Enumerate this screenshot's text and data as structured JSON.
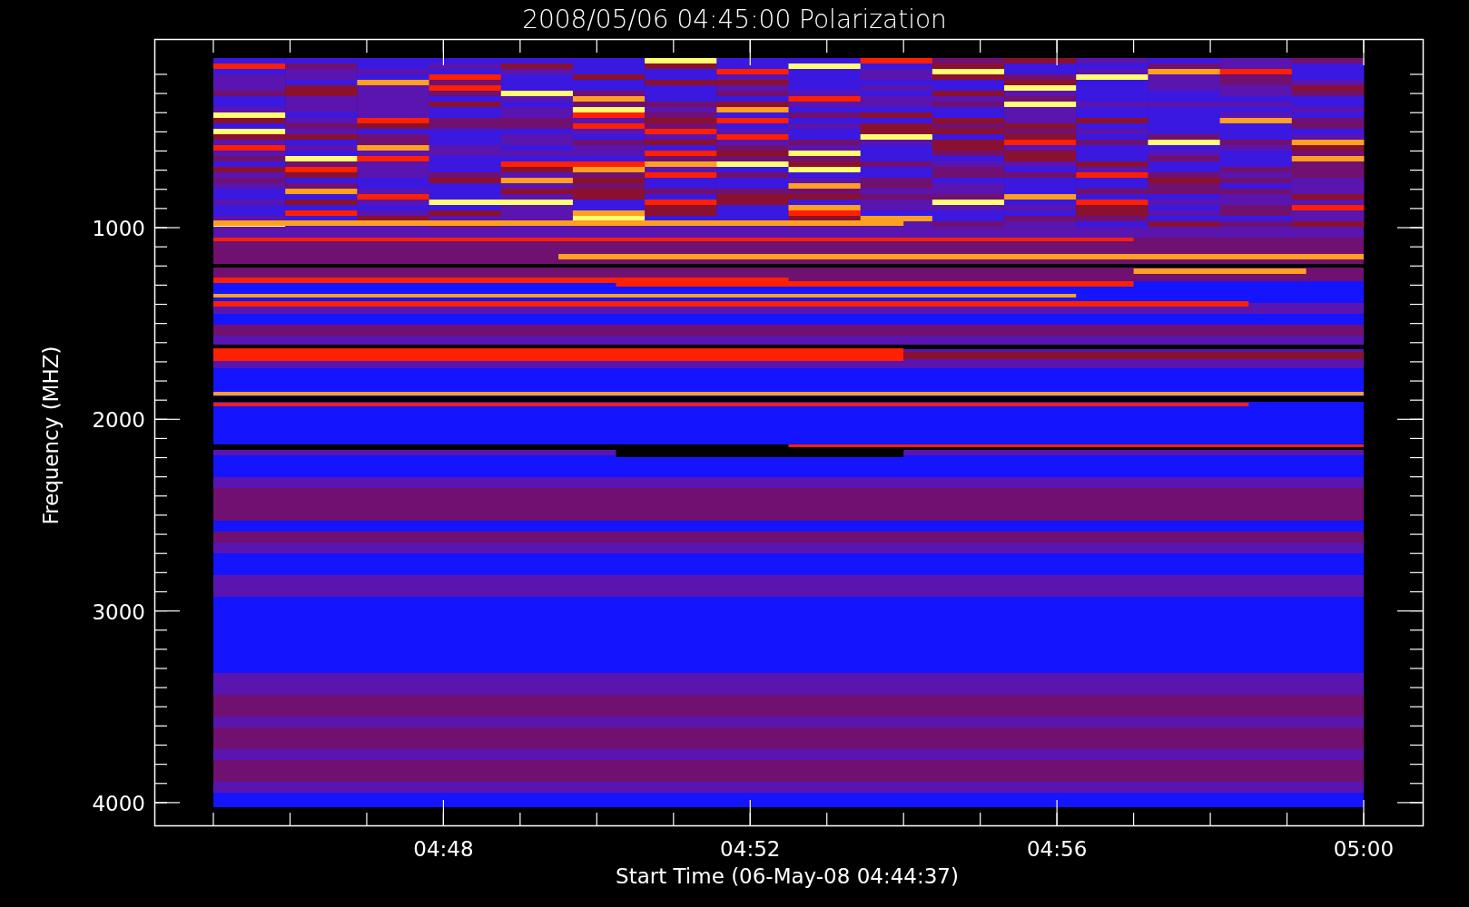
{
  "title": "2008/05/06 04:45:00 Polarization",
  "y_axis": {
    "label": "Frequency (MHZ)",
    "tick_labels": [
      "1000",
      "2000",
      "3000",
      "4000"
    ]
  },
  "x_axis": {
    "label": "Start Time (06-May-08 04:44:37)",
    "tick_labels": [
      "04:48",
      "04:52",
      "04:56",
      "05:00"
    ]
  }
}
